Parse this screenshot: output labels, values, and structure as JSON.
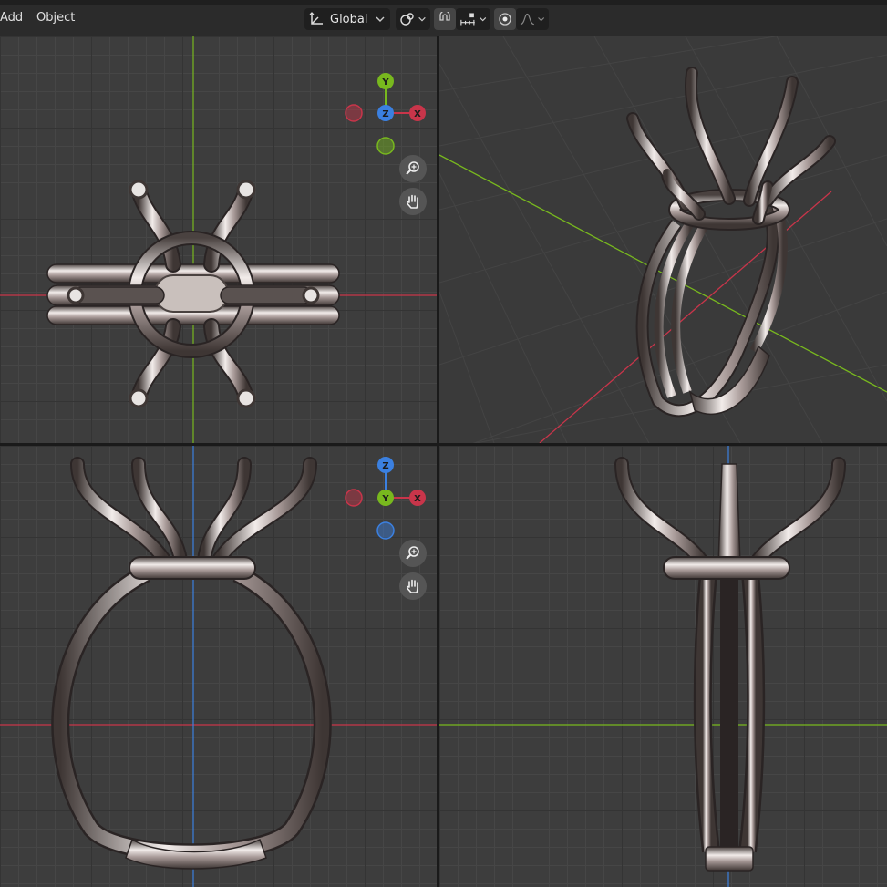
{
  "header": {
    "menu": [
      {
        "label": "Add"
      },
      {
        "label": "Object"
      }
    ],
    "orientation": {
      "label": "Global",
      "icon": "transform-orientation-icon"
    },
    "pivot": {
      "icon": "pivot-point-icon"
    },
    "snap": {
      "icon": "snap-magnet-icon",
      "increment_icon": "snap-increment-icon"
    },
    "proportional": {
      "icon": "proportional-editing-icon",
      "falloff_icon": "falloff-curve-icon"
    }
  },
  "viewports": {
    "top_left": {
      "view": "top",
      "gizmo": {
        "up": "Y",
        "center": "Z",
        "right": "X",
        "left": "-X",
        "down": "-Y"
      }
    },
    "top_right": {
      "view": "perspective"
    },
    "bottom_left": {
      "view": "front",
      "gizmo": {
        "up": "Z",
        "center": "Y",
        "right": "X",
        "left": "-X",
        "down": "-Z"
      }
    },
    "bottom_right": {
      "view": "side"
    }
  },
  "colors": {
    "axis_x": "#c8354a",
    "axis_y": "#78b81e",
    "axis_z": "#3b80e0",
    "metal_mid": "#a89a98",
    "metal_dark": "#3e3634",
    "metal_light": "#f2ecea"
  }
}
